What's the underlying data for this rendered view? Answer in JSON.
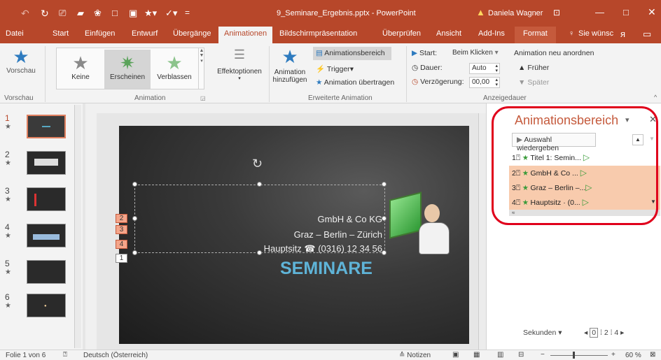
{
  "titlebar": {
    "filename": "9_Seminare_Ergebnis.pptx - PowerPoint",
    "user": "Daniela Wagner",
    "warning_icon": "warning-icon"
  },
  "tabs": [
    "Datei",
    "Start",
    "Einfügen",
    "Entwurf",
    "Übergänge",
    "Animationen",
    "Bildschirmpräsentation",
    "Überprüfen",
    "Ansicht",
    "Add-Ins",
    "Format"
  ],
  "tell_me": "Sie wünsc",
  "ribbon": {
    "vorschau": "Vorschau",
    "vorschau_group": "Vorschau",
    "keine": "Keine",
    "erscheinen": "Erscheinen",
    "verblassen": "Verblassen",
    "animation_group": "Animation",
    "effektoptionen": "Effektoptionen",
    "animation_hinzufuegen_1": "Animation",
    "animation_hinzufuegen_2": "hinzufügen",
    "animationsbereich": "Animationsbereich",
    "trigger": "Trigger",
    "animation_uebertragen": "Animation übertragen",
    "erweiterte_group": "Erweiterte Animation",
    "start_label": "Start:",
    "start_value": "Beim Klicken",
    "dauer_label": "Dauer:",
    "dauer_value": "Auto",
    "verzoegerung_label": "Verzögerung:",
    "verzoegerung_value": "00,00",
    "anordnen": "Animation neu anordnen",
    "frueher": "Früher",
    "spaeter": "Später",
    "anzeigedauer_group": "Anzeigedauer"
  },
  "slides": [
    "1",
    "2",
    "3",
    "4",
    "5",
    "6"
  ],
  "slide": {
    "line1": "GmbH & Co KG",
    "line2": "Graz – Berlin – Zürich",
    "line3": "Hauptsitz ☎ (0316) 12 34 56",
    "title": "SEMINARE",
    "markers": [
      "2",
      "3",
      "4",
      "1"
    ]
  },
  "animpane": {
    "title": "Animationsbereich",
    "play_button": "Auswahl wiedergeben",
    "items": [
      {
        "num": "1",
        "label": "Titel 1: Semin..."
      },
      {
        "num": "2",
        "label": "GmbH & Co ..."
      },
      {
        "num": "3",
        "label": "Graz – Berlin –..."
      },
      {
        "num": "4",
        "label": "Hauptsitz · (0..."
      }
    ],
    "seconds": "Sekunden",
    "timeline": [
      "0",
      "2",
      "4"
    ]
  },
  "status": {
    "slide_info": "Folie 1 von 6",
    "language": "Deutsch (Österreich)",
    "notes": "Notizen",
    "zoom": "60 %"
  },
  "colors": {
    "accent": "#b7472a",
    "highlight": "#f8cbad",
    "annot": "#e0001b"
  }
}
